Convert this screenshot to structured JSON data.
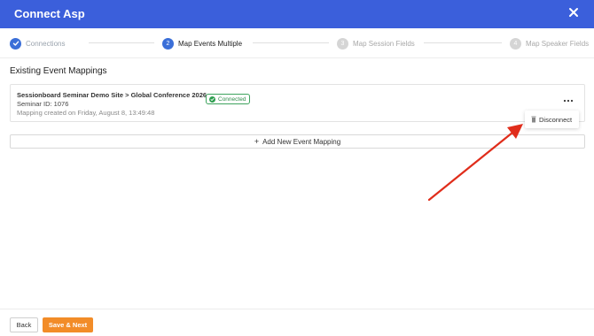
{
  "header": {
    "title": "Connect Asp",
    "close_icon": "close-icon"
  },
  "colors": {
    "header": "#3b5fdb",
    "step_active": "#3b6fd8",
    "step_pending": "#d5d5d5",
    "connected": "#2e9e4f",
    "primary_button": "#f28c28",
    "annotation_arrow": "#e02d1b"
  },
  "stepper": {
    "steps": [
      {
        "number": "1",
        "label": "Connections",
        "status": "done",
        "icon": "check-icon"
      },
      {
        "number": "2",
        "label": "Map Events Multiple",
        "status": "active"
      },
      {
        "number": "3",
        "label": "Map Session Fields",
        "status": "pending"
      },
      {
        "number": "4",
        "label": "Map Speaker Fields",
        "status": "pending"
      }
    ]
  },
  "section": {
    "title": "Existing Event Mappings"
  },
  "mapping": {
    "name": "Sessionboard Seminar Demo Site > Global Conference 2026",
    "status": "Connected",
    "status_icon": "check-circle-icon",
    "seminar_id": "Seminar ID: 1076",
    "created": "Mapping created on Friday, August 8, 13:49:48",
    "more_icon": "more-horizontal-icon"
  },
  "menu": {
    "disconnect_label": "Disconnect",
    "disconnect_icon": "trash-icon"
  },
  "add_mapping": {
    "label": "Add New Event Mapping",
    "icon": "plus-icon",
    "glyph": "+"
  },
  "footer": {
    "back_label": "Back",
    "save_next_label": "Save & Next"
  }
}
